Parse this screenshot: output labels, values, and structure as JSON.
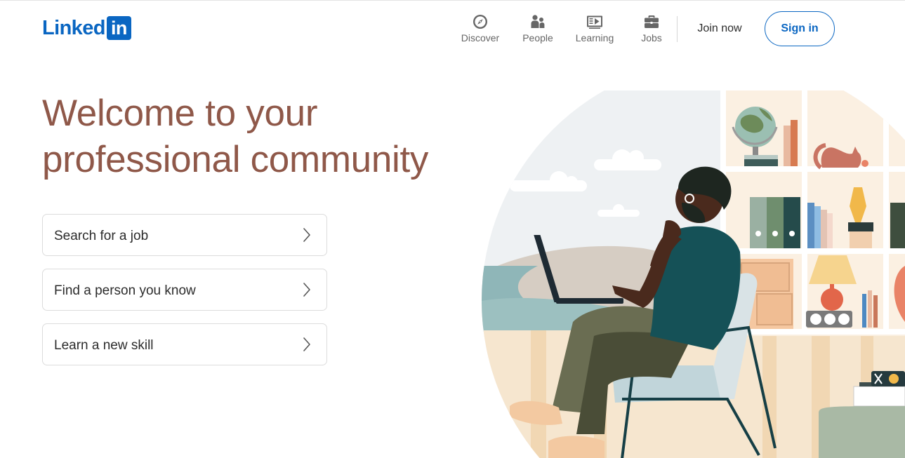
{
  "header": {
    "logo_text": "Linked",
    "logo_badge": "in",
    "nav": [
      {
        "label": "Discover",
        "icon": "compass-icon"
      },
      {
        "label": "People",
        "icon": "people-icon"
      },
      {
        "label": "Learning",
        "icon": "learning-video-icon"
      },
      {
        "label": "Jobs",
        "icon": "briefcase-icon"
      }
    ],
    "join_now": "Join now",
    "sign_in": "Sign in"
  },
  "hero": {
    "title_line1": "Welcome to your",
    "title_line2": "professional community",
    "options": [
      {
        "label": "Search for a job",
        "icon": "chevron-right-icon"
      },
      {
        "label": "Find a person you know",
        "icon": "chevron-right-icon"
      },
      {
        "label": "Learn a new skill",
        "icon": "chevron-right-icon"
      }
    ]
  },
  "colors": {
    "brand": "#0a66c2",
    "title": "#8f5849",
    "nav_text": "#666666"
  }
}
